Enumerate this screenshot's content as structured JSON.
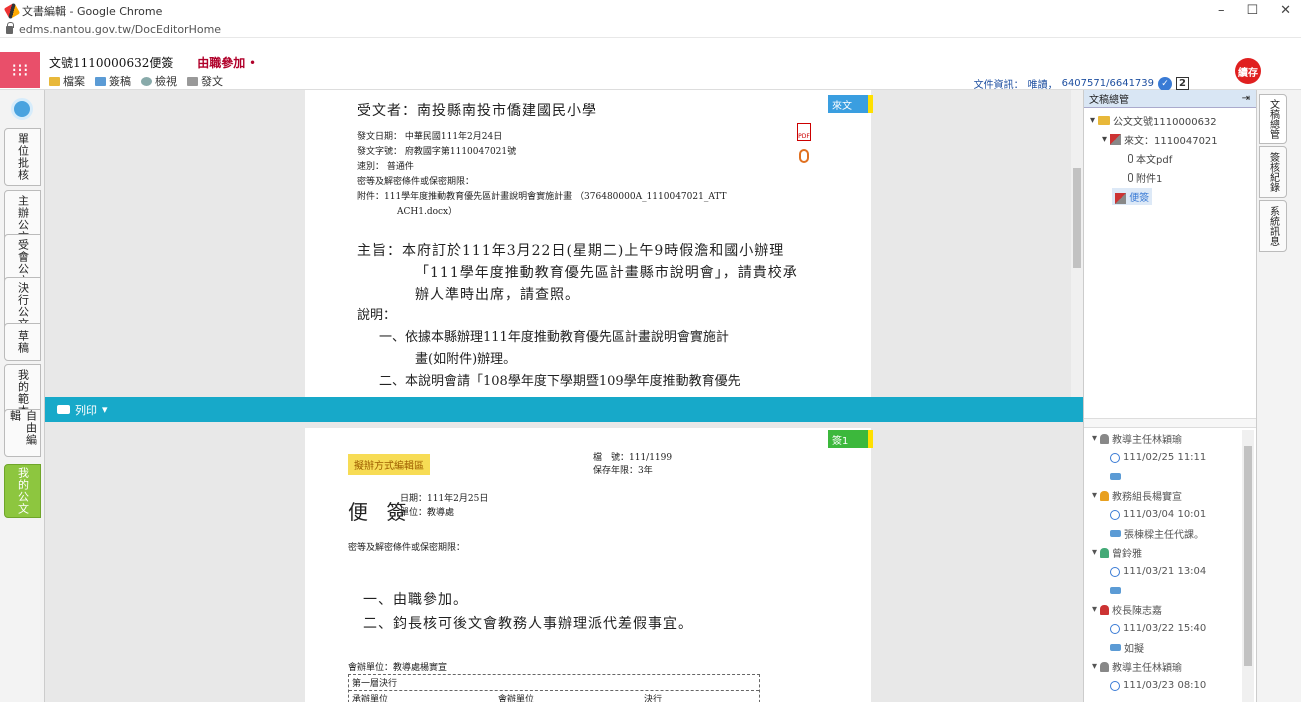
{
  "window": {
    "title": "文書編輯 - Google Chrome",
    "url": "edms.nantou.gov.tw/DocEditorHome",
    "controls": [
      "–",
      "☐",
      "✕"
    ]
  },
  "header": {
    "doc_no": "文號1110000632便簽",
    "sub_status": "由職參加",
    "menu": [
      "檔案",
      "簽稿",
      "檢視",
      "發文"
    ],
    "doc_info_label": "文件資訊：",
    "doc_info_value": "唯讀，",
    "doc_info_link": "6407571/6641739",
    "badge": "2",
    "stamp": "續存"
  },
  "left_tabs": [
    "單位批核",
    "主辦公文",
    "受會公文",
    "決行公文",
    "草稿",
    "我的範本",
    "自由編輯",
    "我的公文"
  ],
  "top_doc": {
    "tag": "來文",
    "recipient": "受文者：南投縣南投市僑建國民小學",
    "meta": [
      "發文日期： 中華民國111年2月24日",
      "發文字號： 府教國字第1110047021號",
      "速別： 普通件",
      "密等及解密條件或保密期限：",
      "附件：111學年度推動教育優先區計畫說明會實施計畫 （376480000A_1110047021_ATT",
      "ACH1.docx）"
    ],
    "subject": [
      "主旨：本府訂於111年3月22日(星期二)上午9時假澹和國小辦理",
      "「111學年度推動教育優先區計畫縣市說明會」，請貴校承",
      "辦人準時出席，請查照。"
    ],
    "expl_title": "說明：",
    "expl": [
      "一、依據本縣辦理111年度推動教育優先區計畫說明會實施計",
      "畫(如附件)辦理。",
      "二、本說明會請「108學年度下學期暨109學年度推動教育優先"
    ]
  },
  "print_bar": {
    "label": "列印"
  },
  "bottom_doc": {
    "tag": "簽1",
    "label": "擬辦方式編輯區",
    "file_no": "檔　號：111/1199",
    "retention": "保存年限：3年",
    "memo": "便 簽",
    "date": "日期：111年2月25日",
    "unit": "單位：教導處",
    "secret": "密等及解密條件或保密期限：",
    "items": [
      "一、由職參加。",
      "二、鈞長核可後文會教務人事辦理派代差假事宜。"
    ],
    "coop": "會辦單位：教導處楊實宣",
    "table": [
      "第一層決行",
      "承辦單位",
      "會辦單位",
      "決行"
    ]
  },
  "right_panel": {
    "title": "文稿總管",
    "tree": [
      "公文文號1110000632",
      "來文：1110047021",
      "本文pdf",
      "附件1",
      "便簽"
    ],
    "history": [
      {
        "name": "教導主任林穎瑜",
        "time": "111/02/25 11:11",
        "comment": ""
      },
      {
        "name": "教務組長楊實宣",
        "time": "111/03/04 10:01",
        "comment": "張棟樑主任代課。"
      },
      {
        "name": "曾鈴雅",
        "time": "111/03/21 13:04",
        "comment": ""
      },
      {
        "name": "校長陳志嘉",
        "time": "111/03/22 15:40",
        "comment": "如擬"
      },
      {
        "name": "教導主任林穎瑜",
        "time": "111/03/23 08:10",
        "comment": ""
      }
    ]
  },
  "right_tabs": [
    "文稿總管",
    "簽核紀錄",
    "系統訊息"
  ]
}
